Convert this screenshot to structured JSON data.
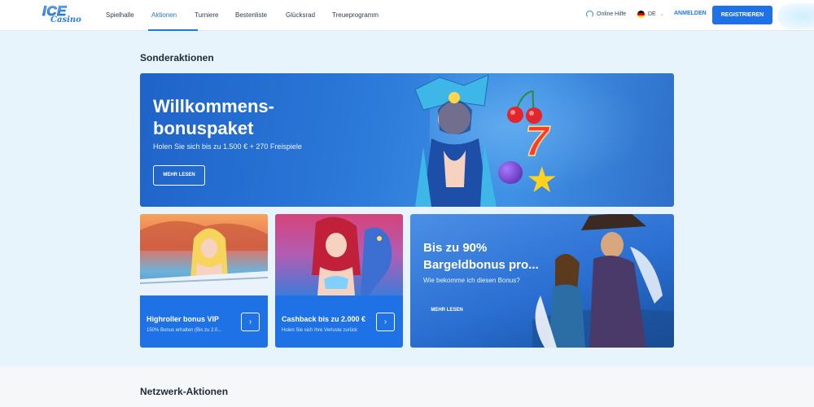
{
  "header": {
    "logo_main": "ICE",
    "logo_sub": "Casino",
    "nav": [
      {
        "label": "Spielhalle"
      },
      {
        "label": "Aktionen"
      },
      {
        "label": "Turniere"
      },
      {
        "label": "Bestenliste"
      },
      {
        "label": "Glücksrad"
      },
      {
        "label": "Treueprogramm"
      }
    ],
    "active_nav": "Aktionen",
    "help_label": "Online Hilfe",
    "lang_label": "DE",
    "login_label": "ANMELDEN",
    "register_label": "REGISTRIEREN"
  },
  "sections": {
    "special_title": "Sonderaktionen",
    "network_title": "Netzwerk-Aktionen"
  },
  "hero": {
    "title_line1": "Willkommens-",
    "title_line2": "bonuspaket",
    "subtitle": "Holen Sie sich bis zu 1.500 € + 270 Freispiele",
    "button": "MEHR LESEN"
  },
  "cards": [
    {
      "title": "Highroller bonus VIP",
      "desc": "150% Bonus erhalten (Bis zu 2.0...",
      "arrow": "›"
    },
    {
      "title": "Cashback bis zu 2.000 €",
      "desc": "Holen Sie sich Ihre Verluste zurück",
      "arrow": "›"
    }
  ],
  "big_card": {
    "title_line1": "Bis zu 90%",
    "title_line2": "Bargeldbonus pro...",
    "subtitle": "Wie bekomme ich diesen Bonus?",
    "button": "MEHR LESEN"
  },
  "colors": {
    "accent": "#1f72e6",
    "page_bg": "#e8f4fb"
  }
}
